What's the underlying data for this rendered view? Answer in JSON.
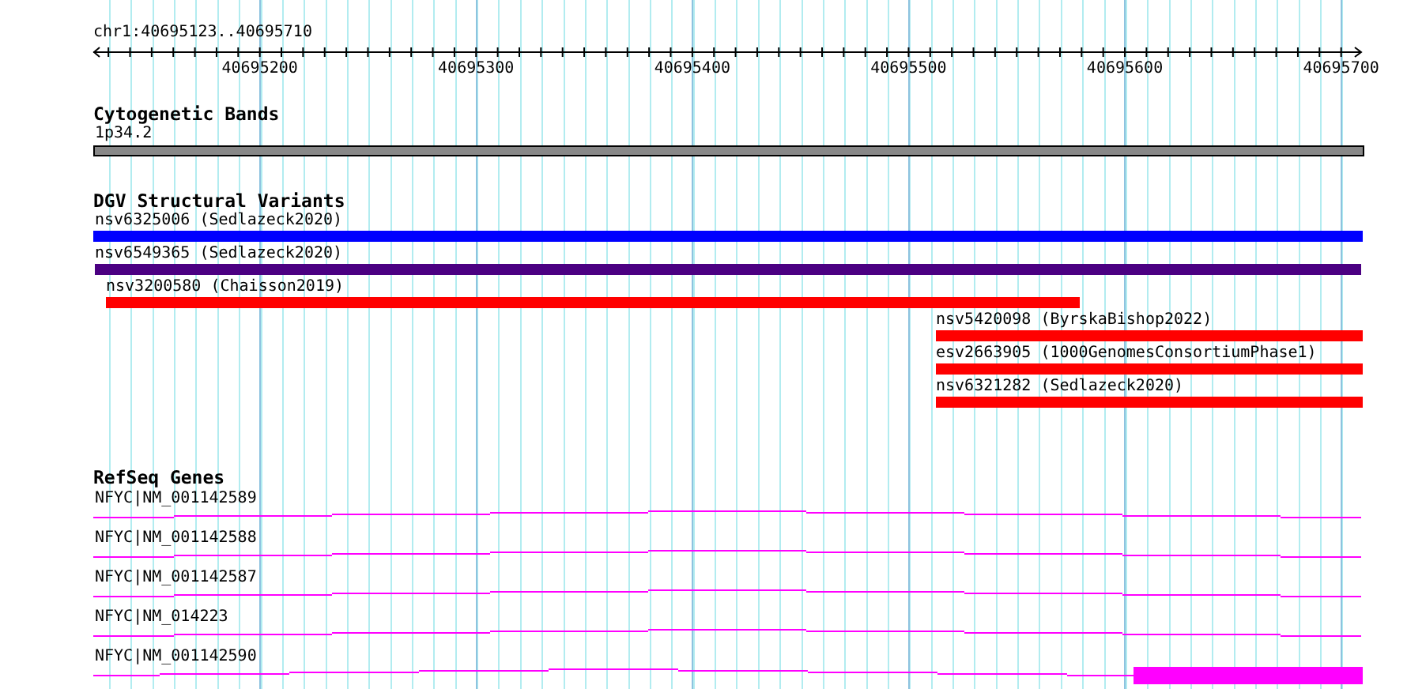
{
  "ruler": {
    "position": "chr1:40695123..40695710",
    "tick_labels": [
      "40695200",
      "40695300",
      "40695400",
      "40695500",
      "40695600",
      "40695700"
    ]
  },
  "tracks": [
    {
      "kind": "cytoband",
      "title": "Cytogenetic Bands",
      "items": [
        {
          "label": "1p34.2"
        }
      ]
    },
    {
      "kind": "variants",
      "title": "DGV Structural Variants",
      "items": [
        {
          "label": "nsv6325006 (Sedlazeck2020)",
          "color": "#0000ff"
        },
        {
          "label": "nsv6549365 (Sedlazeck2020)",
          "color": "#4b0082"
        },
        {
          "label": "nsv3200580 (Chaisson2019)",
          "color": "#ff0000"
        },
        {
          "label": "nsv5420098 (ByrskaBishop2022)",
          "color": "#ff0000"
        },
        {
          "label": "esv2663905 (1000GenomesConsortiumPhase1)",
          "color": "#ff0000"
        },
        {
          "label": "nsv6321282 (Sedlazeck2020)",
          "color": "#ff0000"
        }
      ]
    },
    {
      "kind": "genes",
      "title": "RefSeq Genes",
      "items": [
        {
          "label": "NFYC|NM_001142589",
          "exon": false
        },
        {
          "label": "NFYC|NM_001142588",
          "exon": false
        },
        {
          "label": "NFYC|NM_001142587",
          "exon": false
        },
        {
          "label": "NFYC|NM_014223",
          "exon": false
        },
        {
          "label": "NFYC|NM_001142590",
          "exon": true
        }
      ]
    }
  ]
}
